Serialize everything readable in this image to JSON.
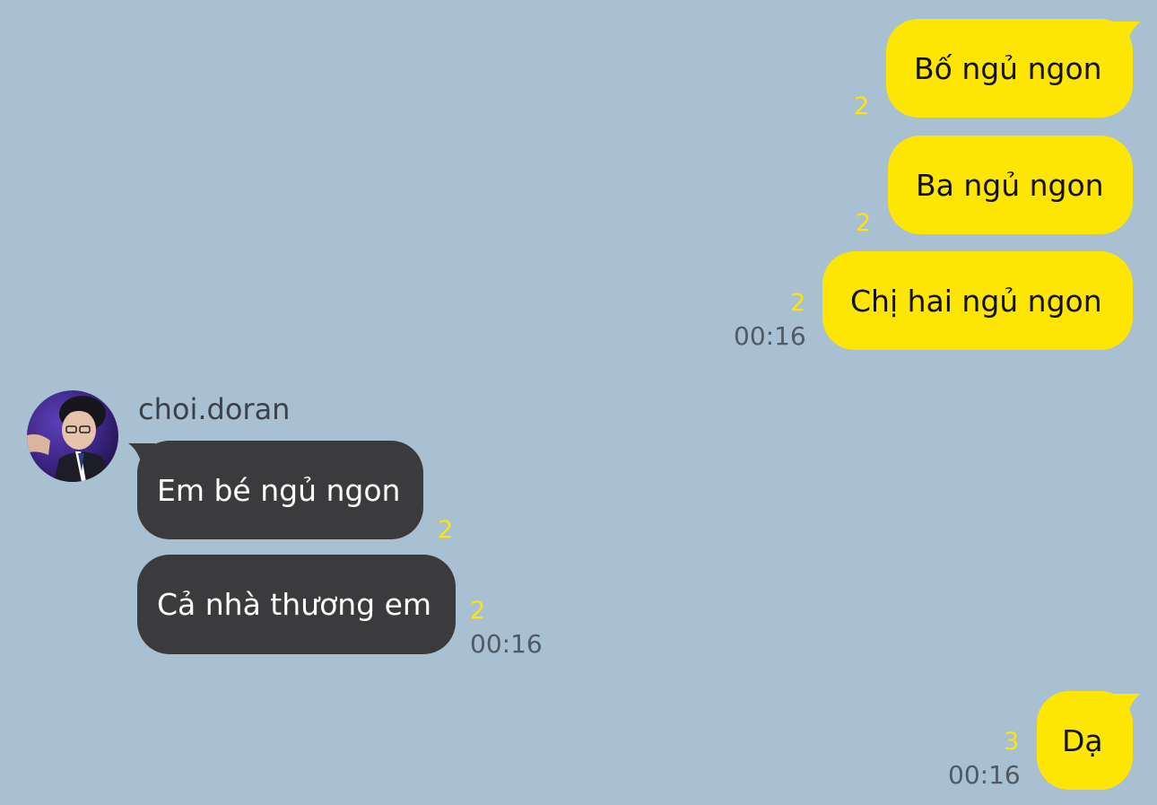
{
  "messages_out_1": {
    "m1": {
      "text": "Bố ngủ ngon",
      "read_count": "2"
    },
    "m2": {
      "text": "Ba ngủ ngon",
      "read_count": "2"
    },
    "m3": {
      "text": "Chị hai ngủ ngon",
      "read_count": "2",
      "time": "00:16"
    }
  },
  "incoming": {
    "sender": "choi.doran",
    "m1": {
      "text": "Em bé ngủ ngon",
      "read_count": "2"
    },
    "m2": {
      "text": "Cả nhà thương em",
      "read_count": "2",
      "time": "00:16"
    }
  },
  "messages_out_2": {
    "m1": {
      "text": "Dạ",
      "read_count": "3",
      "time": "00:16"
    }
  },
  "colors": {
    "background": "#a9bfd2",
    "outgoing_bubble": "#fde504",
    "incoming_bubble": "#3b3b3d",
    "read_count": "#fde504",
    "time": "#4f5a63"
  }
}
